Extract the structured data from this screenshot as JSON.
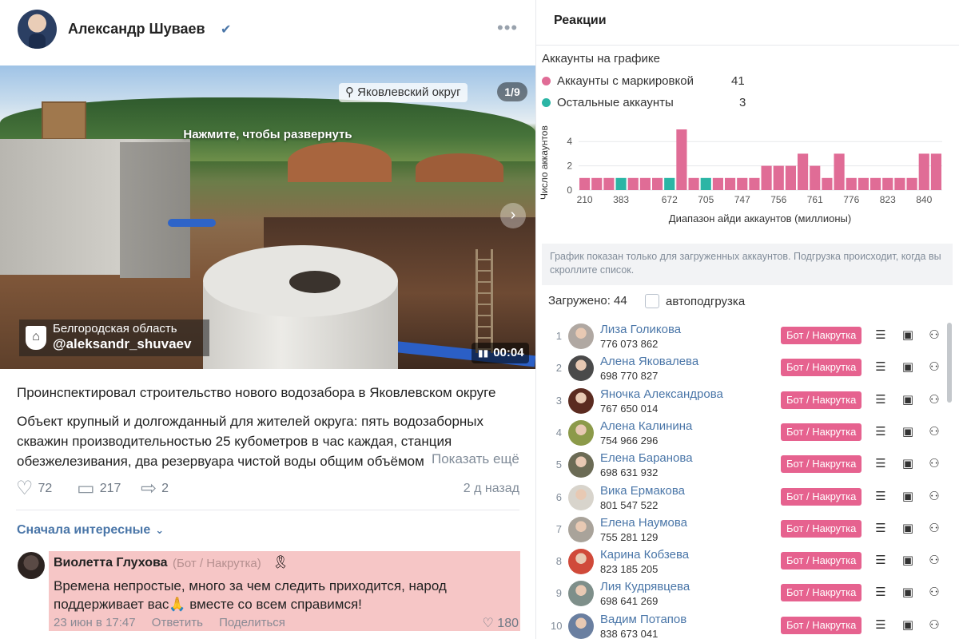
{
  "post": {
    "author": "Александр Шуваев",
    "verified_icon": "check-icon",
    "more_icon": "more-horizontal-icon",
    "media": {
      "location": "Яковлевский округ",
      "counter": "1/9",
      "expand_hint": "Нажмите, чтобы развернуть",
      "region": "Белгородская область",
      "handle": "@aleksandr_shuvaev",
      "duration": "00:04"
    },
    "title": "Проинспектировал строительство нового водозабора в Яковлевском округе",
    "text_lines": [
      "Объект крупный и долгожданный для жителей округа: пять водозаборных",
      "скважин производительностью 25 кубометров в час каждая, станция",
      "обезжелезивания, два резервуара чистой воды общим объёмом"
    ],
    "show_more": "Показать ещё",
    "likes": "72",
    "comments": "217",
    "shares": "2",
    "time": "2 д назад",
    "sort_label": "Сначала интересные"
  },
  "comment": {
    "author": "Виолетта Глухова",
    "tag": "(Бот / Накрутка)",
    "text_line1": "Времена непростые, много за чем следить приходится, народ",
    "text_line2": "поддерживает вас🙏 вместе со всем справимся!",
    "date": "23 июн в 17:47",
    "reply": "Ответить",
    "share": "Поделиться",
    "likes": "180"
  },
  "panel": {
    "title": "Реакции",
    "legend_title": "Аккаунты на графике",
    "legend": [
      {
        "label": "Аккаунты с маркировкой",
        "count": "41",
        "color": "#e06c96"
      },
      {
        "label": "Остальные аккаунты",
        "count": "3",
        "color": "#2bb5a5"
      }
    ],
    "note": "График показан только для загруженных аккаунтов. Подгрузка происходит, когда вы скроллите список.",
    "loaded": "Загружено: 44",
    "autoload": "автоподгрузка",
    "badge": "Бот / Накрутка",
    "users": [
      {
        "num": "1",
        "name": "Лиза Голикова",
        "id": "776 073 862",
        "avatar": "#b0a8a2"
      },
      {
        "num": "2",
        "name": "Алена Яковалева",
        "id": "698 770 827",
        "avatar": "#4a4a4a"
      },
      {
        "num": "3",
        "name": "Яночка Александрова",
        "id": "767 650 014",
        "avatar": "#5b2b20"
      },
      {
        "num": "4",
        "name": "Алена Калинина",
        "id": "754 966 296",
        "avatar": "#8c9a4a"
      },
      {
        "num": "5",
        "name": "Елена Баранова",
        "id": "698 631 932",
        "avatar": "#6b6b55"
      },
      {
        "num": "6",
        "name": "Вика Ермакова",
        "id": "801 547 522",
        "avatar": "#d8d4cc"
      },
      {
        "num": "7",
        "name": "Елена Наумова",
        "id": "755 281 129",
        "avatar": "#a9a39a"
      },
      {
        "num": "8",
        "name": "Карина Кобзева",
        "id": "823 185 205",
        "avatar": "#d04a3a"
      },
      {
        "num": "9",
        "name": "Лия Кудрявцева",
        "id": "698 641 269",
        "avatar": "#7e8f8a"
      },
      {
        "num": "10",
        "name": "Вадим Потапов",
        "id": "838 673 041",
        "avatar": "#6a7fa0"
      }
    ]
  },
  "chart_data": {
    "type": "bar",
    "title": "",
    "xlabel": "Диапазон айди аккаунтов (миллионы)",
    "ylabel": "Число аккаунтов",
    "ylim": [
      0,
      5
    ],
    "yticks": [
      0,
      2,
      4
    ],
    "xtick_labels": [
      "210",
      "383",
      "672",
      "705",
      "747",
      "756",
      "761",
      "776",
      "823",
      "840"
    ],
    "xtick_positions": [
      0,
      3,
      7,
      10,
      13,
      16,
      19,
      22,
      25,
      28
    ],
    "series": [
      {
        "name": "Аккаунты с маркировкой",
        "color": "#e06c96",
        "values": [
          1,
          1,
          1,
          0,
          1,
          1,
          1,
          0,
          5,
          1,
          0,
          1,
          1,
          1,
          1,
          2,
          2,
          2,
          3,
          2,
          1,
          3,
          1,
          1,
          1,
          1,
          1,
          1,
          3,
          3
        ]
      },
      {
        "name": "Остальные аккаунты",
        "color": "#2bb5a5",
        "values": [
          0,
          0,
          0,
          1,
          0,
          0,
          0,
          1,
          0,
          0,
          1,
          0,
          0,
          0,
          0,
          0,
          0,
          0,
          0,
          0,
          0,
          0,
          0,
          0,
          0,
          0,
          0,
          0,
          0,
          0
        ]
      }
    ]
  }
}
